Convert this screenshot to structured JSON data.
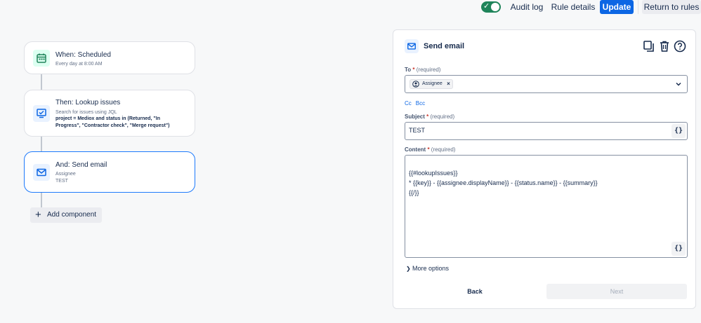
{
  "topbar": {
    "toggle_enabled": true,
    "audit_log": "Audit log",
    "rule_details": "Rule details",
    "update": "Update",
    "return_to_rules": "Return to rules"
  },
  "flow": {
    "trigger": {
      "title": "When: Scheduled",
      "subtitle": "Every day at 8:00 AM",
      "icon": "calendar-icon"
    },
    "action1": {
      "title": "Then: Lookup issues",
      "subtitle": "Search for issues using JQL",
      "query_line1": "project = Mediox and status in (Returned, \"In",
      "query_line2": "Progress\", \"Contractor check\", \"Merge request\")",
      "icon": "search-list-icon"
    },
    "action2": {
      "title": "And: Send email",
      "subtitle1": "Assignee",
      "subtitle2": "TEST",
      "icon": "mail-icon"
    },
    "add_component": "Add component"
  },
  "panel": {
    "title": "Send email",
    "to": {
      "label": "To",
      "required_hint": "(required)",
      "chip": "Assignee"
    },
    "cc": "Cc",
    "bcc": "Bcc",
    "subject": {
      "label": "Subject",
      "required_hint": "(required)",
      "value": "TEST",
      "brace": "{}"
    },
    "content": {
      "label": "Content",
      "required_hint": "(required)",
      "line1": "{{#lookupIssues}}",
      "line2": "* {{key}} - {{assignee.displayName}} - {{status.name}} - {{summary}}",
      "line3": "{{/}}",
      "brace": "{}"
    },
    "more_options": "More options",
    "back": "Back",
    "next": "Next"
  },
  "colors": {
    "accent": "#0c66e4",
    "toggle_on": "#1f845a",
    "selected_border": "#1d7afc"
  }
}
